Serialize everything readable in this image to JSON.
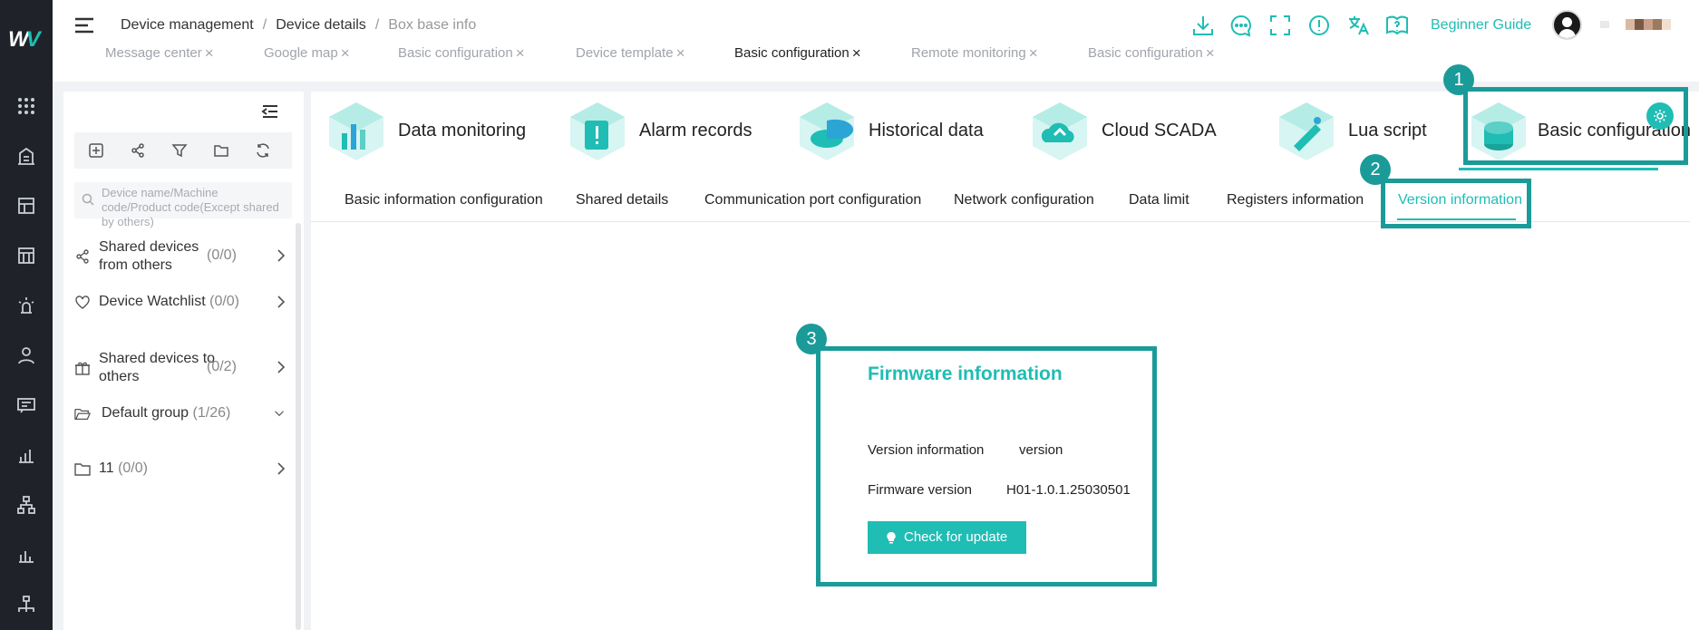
{
  "header": {
    "breadcrumb": [
      "Device management",
      "Device details",
      "Box base info"
    ],
    "beginner_guide": "Beginner Guide"
  },
  "tabs": [
    {
      "label": "Message center"
    },
    {
      "label": "Google map"
    },
    {
      "label": "Basic configuration"
    },
    {
      "label": "Device template"
    },
    {
      "label": "Basic configuration",
      "active": true
    },
    {
      "label": "Remote monitoring"
    },
    {
      "label": "Basic configuration"
    }
  ],
  "sidebar": {
    "search_placeholder": "Device name/Machine code/Product code(Except shared by others)",
    "groups": [
      {
        "label": "Shared devices from others",
        "count": "(0/0)",
        "icon": "share-icon"
      },
      {
        "label": "Device Watchlist",
        "count": "(0/0)",
        "icon": "heart-icon"
      },
      {
        "label": "Shared devices to others",
        "count": "(0/2)",
        "icon": "gift-icon"
      },
      {
        "label": "Default group",
        "count": "(1/26)",
        "icon": "folder-open-icon"
      },
      {
        "label": "11",
        "count": "(0/0)",
        "icon": "folder-icon"
      }
    ]
  },
  "modules": [
    {
      "label": "Data monitoring"
    },
    {
      "label": "Alarm records"
    },
    {
      "label": "Historical data"
    },
    {
      "label": "Cloud SCADA"
    },
    {
      "label": "Lua script"
    },
    {
      "label": "Basic configuration",
      "active": true
    }
  ],
  "subtabs": [
    {
      "label": "Basic information configuration"
    },
    {
      "label": "Shared details"
    },
    {
      "label": "Communication port configuration"
    },
    {
      "label": "Network configuration"
    },
    {
      "label": "Data limit"
    },
    {
      "label": "Registers information"
    },
    {
      "label": "Version information",
      "active": true
    }
  ],
  "firmware": {
    "title": "Firmware information",
    "version_info_label": "Version information",
    "version_info_value": "version",
    "firmware_version_label": "Firmware version",
    "firmware_version_value": "H01-1.0.1.25030501",
    "check_update": "Check for update"
  },
  "annotations": [
    "1",
    "2",
    "3"
  ],
  "colors": {
    "accent": "#1fbdb4",
    "annotation": "#1a9b99",
    "rail": "#1f2329"
  }
}
